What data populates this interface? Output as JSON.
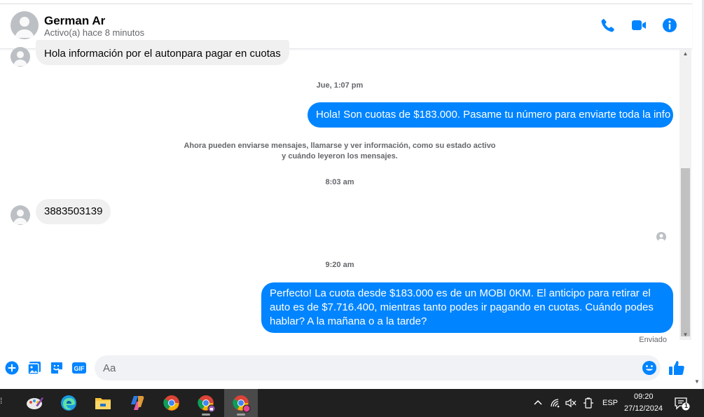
{
  "contact": {
    "name": "German Ar",
    "status": "Activo(a) hace 8 minutos"
  },
  "header_icons": [
    "phone-icon",
    "video-camera-icon",
    "info-icon"
  ],
  "messages": [
    {
      "id": "m1",
      "sender": "contact",
      "text": "Hola información por el autonpara pagar en cuotas"
    },
    {
      "id": "t1",
      "type": "timestamp",
      "text": "Jue, 1:07 pm"
    },
    {
      "id": "m2",
      "sender": "me",
      "text": "Hola! Son cuotas de $183.000. Pasame tu número para enviarte toda la info"
    },
    {
      "id": "s1",
      "type": "system",
      "text": "Ahora pueden enviarse mensajes, llamarse y ver información, como su estado activo y cuándo leyeron los mensajes."
    },
    {
      "id": "t2",
      "type": "timestamp",
      "text": "8:03 am"
    },
    {
      "id": "m3",
      "sender": "contact",
      "text": "3883503139"
    },
    {
      "id": "t3",
      "type": "timestamp",
      "text": "9:20 am"
    },
    {
      "id": "m4",
      "sender": "me",
      "text": "Perfecto! La cuota desde $183.000 es de un MOBI 0KM. El anticipo para retirar el auto es de $7.716.400, mientras tanto podes ir pagando en cuotas. Cuándo podes hablar? A la mañana o a la tarde?"
    }
  ],
  "delivery_status": "Enviado",
  "composer": {
    "placeholder": "Aa",
    "icons": [
      "add-icon",
      "image-icon",
      "sticker-icon",
      "gif-icon",
      "emoji-icon",
      "like-icon"
    ],
    "gif_label": "GIF"
  },
  "taskbar": {
    "apps": [
      "paint-icon",
      "edge-icon",
      "file-explorer-icon",
      "copilot-icon",
      "chrome-icon",
      "chrome-profile-icon",
      "chrome-profile-active-icon"
    ],
    "language": "ESP",
    "time": "09:20",
    "date": "27/12/2024",
    "notification_count": "1"
  },
  "colors": {
    "accent": "#0084ff",
    "incoming_bubble": "#f0f0f0",
    "taskbar": "#202020"
  }
}
